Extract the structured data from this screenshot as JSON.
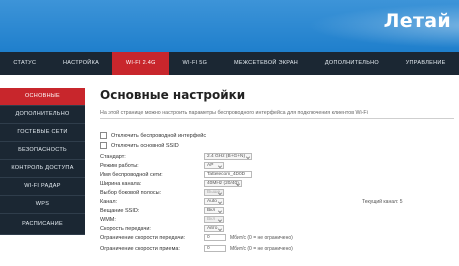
{
  "header": {
    "logo": "Летай"
  },
  "nav": {
    "items": [
      {
        "label": "СТАТУС",
        "active": false
      },
      {
        "label": "НАСТРОЙКА",
        "active": false
      },
      {
        "label": "WI-FI 2.4G",
        "active": true
      },
      {
        "label": "WI-FI 5G",
        "active": false
      },
      {
        "label": "МЕЖСЕТЕВОЙ ЭКРАН",
        "active": false
      },
      {
        "label": "ДОПОЛНИТЕЛЬНО",
        "active": false
      },
      {
        "label": "УПРАВЛЕНИЕ",
        "active": false
      }
    ]
  },
  "sidebar": {
    "items": [
      {
        "label": "ОСНОВНЫЕ",
        "active": true
      },
      {
        "label": "ДОПОЛНИТЕЛЬНО",
        "active": false
      },
      {
        "label": "ГОСТЕВЫЕ СЕТИ",
        "active": false
      },
      {
        "label": "БЕЗОПАСНОСТЬ",
        "active": false
      },
      {
        "label": "КОНТРОЛЬ ДОСТУПА",
        "active": false
      },
      {
        "label": "WI-FI РАДАР",
        "active": false
      },
      {
        "label": "WPS",
        "active": false
      },
      {
        "label": "РАСПИСАНИЕ",
        "active": false
      }
    ]
  },
  "main": {
    "title": "Основные настройки",
    "description": "На этой странице можно настроить параметры беспроводного интерфейса для подключения клиентов Wi-Fi",
    "checkboxes": [
      {
        "label": "Отключить беспроводной интерфейс",
        "checked": false
      },
      {
        "label": "Отключить основной SSID",
        "checked": false
      }
    ],
    "fields": [
      {
        "label": "Стандарт:",
        "value": "2.4 GHz (B+G+N)",
        "type": "select",
        "disabled": false
      },
      {
        "label": "Режим работы:",
        "value": "AP",
        "type": "select",
        "disabled": false
      },
      {
        "label": "Имя беспроводной сети:",
        "value": "Tattelecom_4D0D",
        "type": "text",
        "disabled": false
      },
      {
        "label": "Ширина канала:",
        "value": "40MHz (20/40)",
        "type": "select",
        "disabled": false
      },
      {
        "label": "Выбор боковой полосы:",
        "value": "Выше",
        "type": "select",
        "disabled": true
      },
      {
        "label": "Канал:",
        "value": "Auto",
        "type": "select",
        "disabled": false,
        "side_note": "Текущий канал: 5"
      },
      {
        "label": "Вещание SSID:",
        "value": "Вкл",
        "type": "select",
        "disabled": false
      },
      {
        "label": "WMM:",
        "value": "Вкл",
        "type": "select",
        "disabled": true
      },
      {
        "label": "Скорость передачи:",
        "value": "Авто",
        "type": "select",
        "disabled": false
      },
      {
        "label": "Ограничение скорости передачи:",
        "value": "0",
        "type": "text",
        "disabled": false,
        "note": "Мбит/с (0 = не ограничено)"
      },
      {
        "label": "Ограничение скорости приема:",
        "value": "0",
        "type": "text",
        "disabled": false,
        "note": "Мбит/с (0 = не ограничено)"
      }
    ]
  }
}
